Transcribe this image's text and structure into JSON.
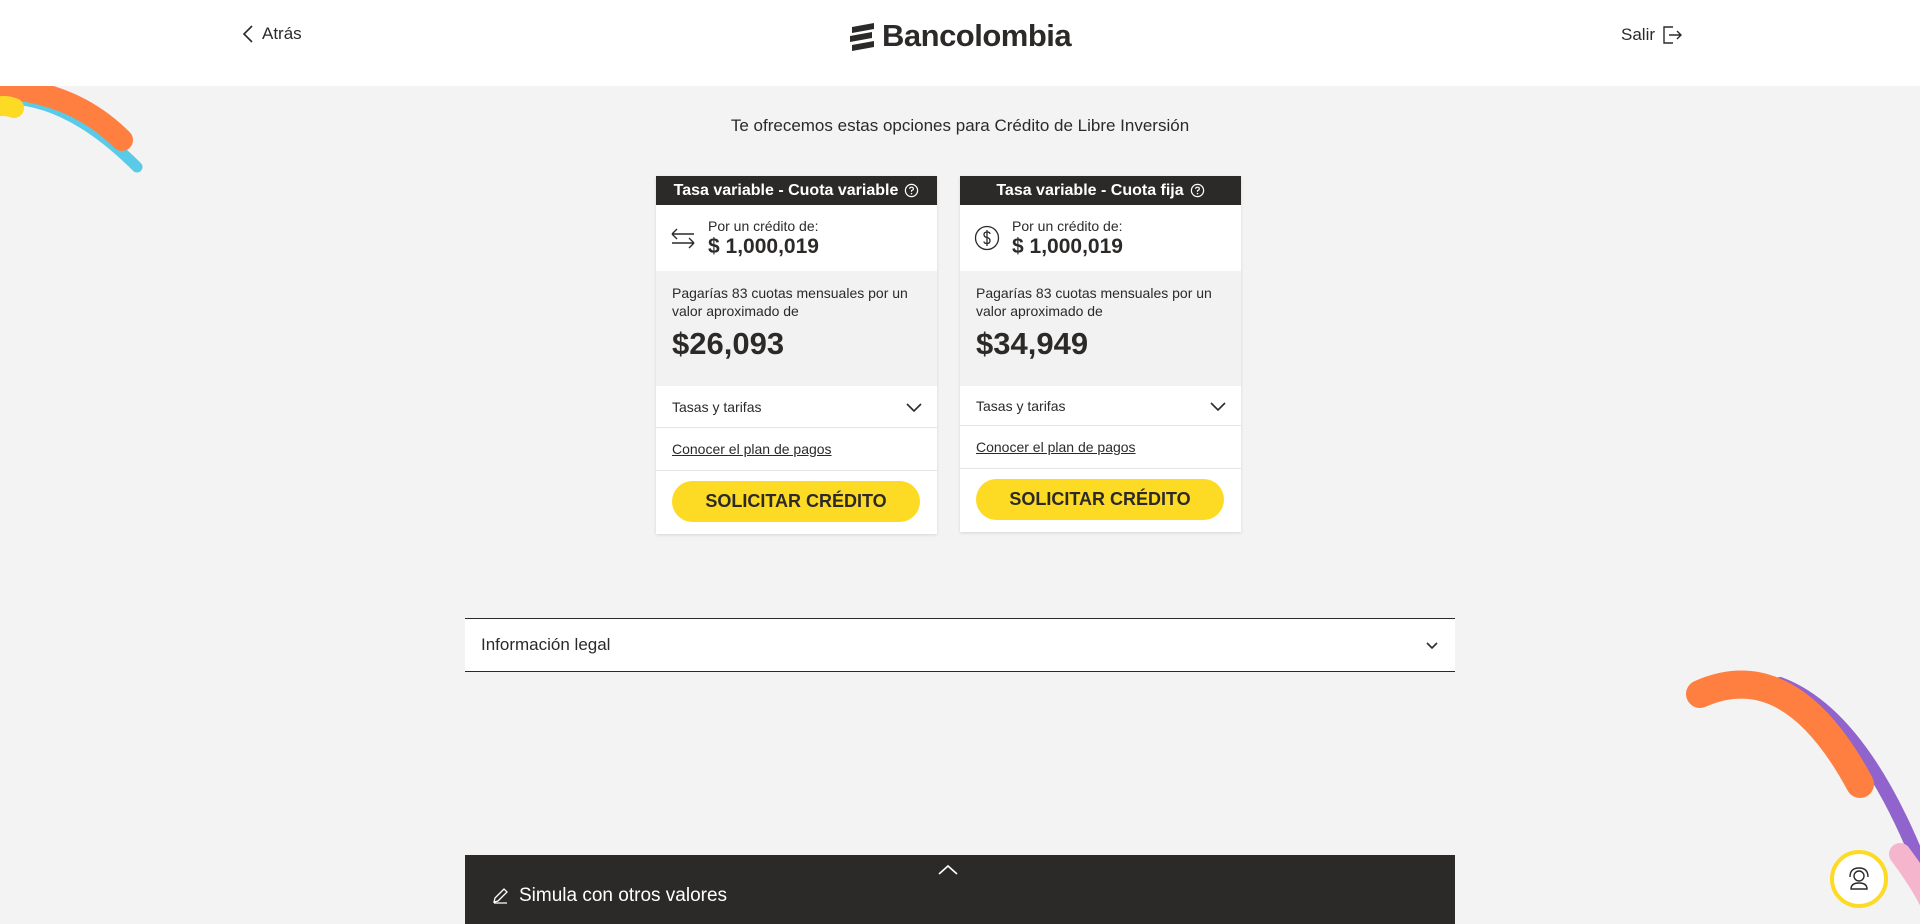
{
  "header": {
    "back_label": "Atrás",
    "logo_text": "Bancolombia",
    "exit_label": "Salir"
  },
  "subtitle": "Te ofrecemos estas opciones para Crédito de Libre Inversión",
  "cards": [
    {
      "title": "Tasa variable - Cuota variable",
      "icon": "arrows-exchange-icon",
      "credit_label": "Por un crédito de:",
      "credit_amount": "$ 1,000,019",
      "payment_desc": "Pagarías 83 cuotas mensuales por un valor aproximado de",
      "payment_amount": "$26,093",
      "rates_label": "Tasas y tarifas",
      "plan_link": "Conocer el plan de pagos",
      "button_label": "SOLICITAR CRÉDITO"
    },
    {
      "title": "Tasa variable - Cuota fija",
      "icon": "dollar-circle-icon",
      "credit_label": "Por un crédito de:",
      "credit_amount": "$ 1,000,019",
      "payment_desc": "Pagarías 83 cuotas mensuales por un valor aproximado de",
      "payment_amount": "$34,949",
      "rates_label": "Tasas y tarifas",
      "plan_link": "Conocer el plan de pagos",
      "button_label": "SOLICITAR CRÉDITO"
    }
  ],
  "legal": {
    "label": "Información legal"
  },
  "simula": {
    "label": "Simula con otros valores"
  },
  "colors": {
    "brand_yellow": "#fdda24",
    "dark": "#2c2a29",
    "background": "#f3f3f3",
    "accent_orange": "#ff7f41",
    "accent_blue": "#59cbe8",
    "accent_purple": "#9063cd",
    "accent_pink": "#f5b6cd"
  }
}
